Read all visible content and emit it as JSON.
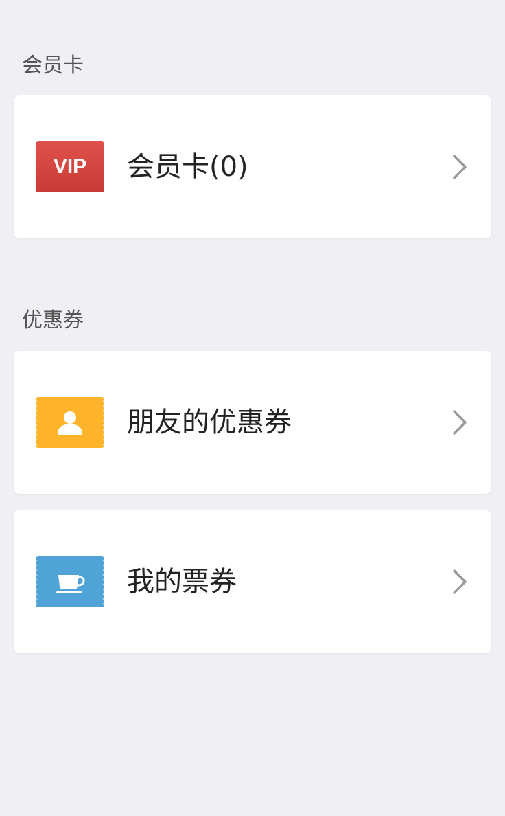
{
  "sections": {
    "membership": {
      "title": "会员卡",
      "card": {
        "label": "会员卡(0)",
        "icon": "vip-badge-icon",
        "icon_text": "VIP",
        "icon_color": "#d8443f"
      }
    },
    "coupons": {
      "title": "优惠券",
      "cards": [
        {
          "label": "朋友的优惠券",
          "icon": "friend-coupon-icon",
          "icon_color": "#fdb42a"
        },
        {
          "label": "我的票券",
          "icon": "cup-ticket-icon",
          "icon_color": "#4fa3d6"
        }
      ]
    }
  }
}
